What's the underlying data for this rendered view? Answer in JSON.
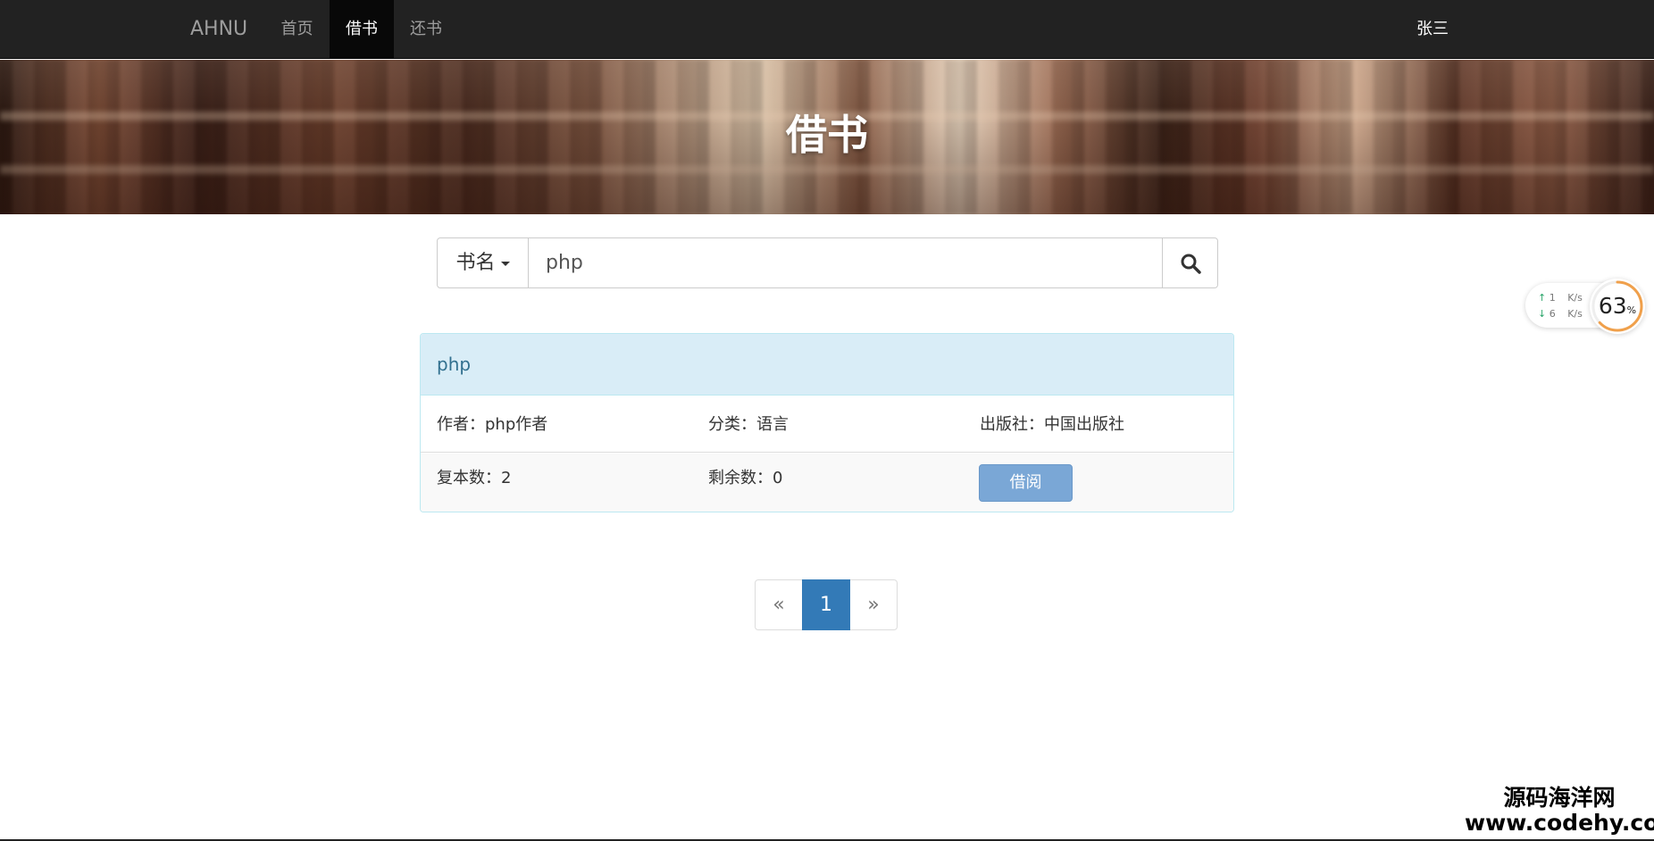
{
  "navbar": {
    "brand": "AHNU",
    "items": [
      {
        "label": "首页",
        "active": false
      },
      {
        "label": "借书",
        "active": true
      },
      {
        "label": "还书",
        "active": false
      }
    ],
    "user": "张三"
  },
  "banner": {
    "title": "借书"
  },
  "search": {
    "type_label": "书名",
    "value": "php",
    "icon": "search-icon"
  },
  "result": {
    "title": "php",
    "author": "作者：php作者",
    "category": "分类：语言",
    "publisher": "出版社：中国出版社",
    "copies": "复本数：2",
    "remaining": "剩余数：0",
    "borrow_label": "借阅"
  },
  "pagination": {
    "prev": "«",
    "pages": [
      "1"
    ],
    "current": "1",
    "next": "»"
  },
  "network_widget": {
    "up": "1",
    "up_unit": "K/s",
    "down": "6",
    "down_unit": "K/s",
    "percent": "63",
    "percent_unit": "%",
    "percent_value": 63
  },
  "watermark": {
    "line1": "源码海洋网",
    "line2": "www.codehy.com"
  },
  "colors": {
    "navbar_bg": "#222222",
    "nav_active": "#080808",
    "panel_heading_bg": "#d9edf7",
    "panel_heading_text": "#31708f",
    "primary": "#337ab7",
    "borrow_button": "#7aa7d6"
  }
}
